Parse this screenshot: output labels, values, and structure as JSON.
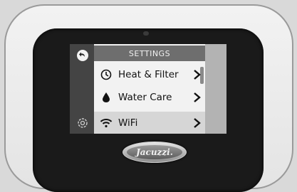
{
  "screen": {
    "title": "SETTINGS",
    "menu": [
      {
        "label": "Heat & Filter",
        "icon": "clock-icon",
        "chevron": ">"
      },
      {
        "label": "Water Care",
        "icon": "water-drop-icon",
        "chevron": ">"
      },
      {
        "label": "WiFi",
        "icon": "wifi-icon",
        "chevron": ">",
        "selected": true
      }
    ],
    "side_icons": [
      "back-icon",
      "settings-ring-icon"
    ]
  },
  "device": {
    "brand": "Jacuzzi."
  }
}
